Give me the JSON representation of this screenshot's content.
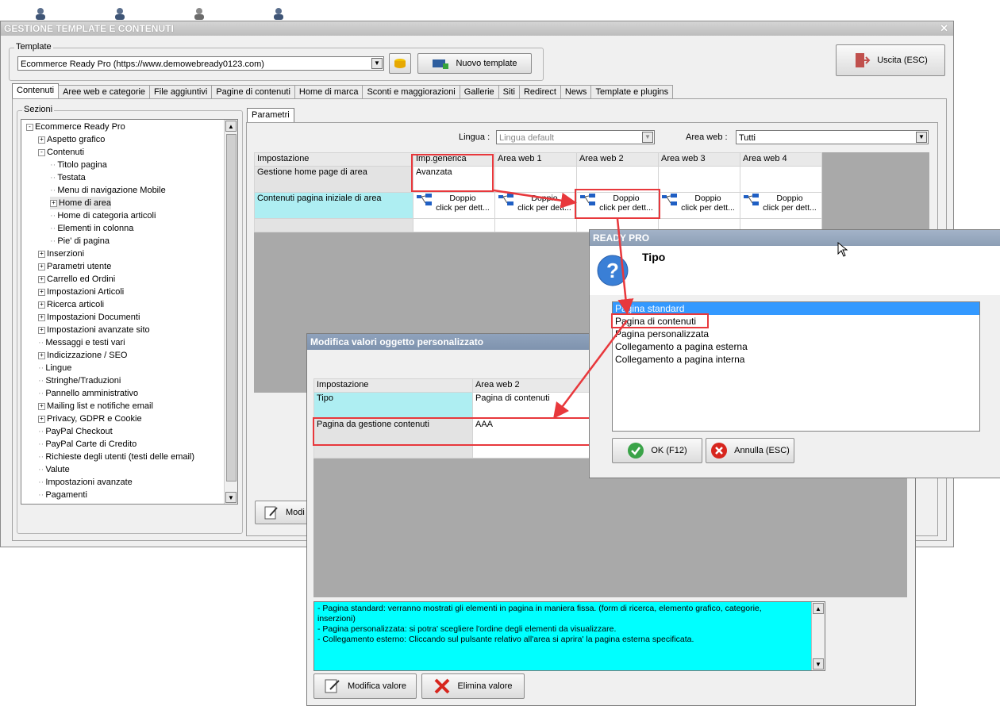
{
  "main_window": {
    "title": "GESTIONE TEMPLATE E CONTENUTI",
    "template_group_label": "Template",
    "template_value": "Ecommerce Ready Pro (https://www.demowebready0123.com)",
    "new_template_button": "Nuovo template",
    "exit_button": "Uscita (ESC)",
    "tabs": [
      "Contenuti",
      "Aree web e categorie",
      "File aggiuntivi",
      "Pagine di contenuti",
      "Home di marca",
      "Sconti e maggiorazioni",
      "Gallerie",
      "Siti",
      "Redirect",
      "News",
      "Template e plugins"
    ],
    "sections_label": "Sezioni",
    "tree": [
      {
        "label": "Ecommerce Ready Pro",
        "level": 0,
        "exp": "-"
      },
      {
        "label": "Aspetto grafico",
        "level": 1,
        "exp": "+"
      },
      {
        "label": "Contenuti",
        "level": 1,
        "exp": "-"
      },
      {
        "label": "Titolo pagina",
        "level": 2,
        "exp": ""
      },
      {
        "label": "Testata",
        "level": 2,
        "exp": ""
      },
      {
        "label": "Menu di navigazione Mobile",
        "level": 2,
        "exp": ""
      },
      {
        "label": "Home di area",
        "level": 2,
        "exp": "+",
        "selected": true
      },
      {
        "label": "Home di categoria articoli",
        "level": 2,
        "exp": ""
      },
      {
        "label": "Elementi in colonna",
        "level": 2,
        "exp": ""
      },
      {
        "label": "Pie' di pagina",
        "level": 2,
        "exp": ""
      },
      {
        "label": "Inserzioni",
        "level": 1,
        "exp": "+"
      },
      {
        "label": "Parametri utente",
        "level": 1,
        "exp": "+"
      },
      {
        "label": "Carrello ed Ordini",
        "level": 1,
        "exp": "+"
      },
      {
        "label": "Impostazioni Articoli",
        "level": 1,
        "exp": "+"
      },
      {
        "label": "Ricerca articoli",
        "level": 1,
        "exp": "+"
      },
      {
        "label": "Impostazioni Documenti",
        "level": 1,
        "exp": "+"
      },
      {
        "label": "Impostazioni avanzate sito",
        "level": 1,
        "exp": "+"
      },
      {
        "label": "Messaggi e testi vari",
        "level": 1,
        "exp": ""
      },
      {
        "label": "Indicizzazione / SEO",
        "level": 1,
        "exp": "+"
      },
      {
        "label": "Lingue",
        "level": 1,
        "exp": ""
      },
      {
        "label": "Stringhe/Traduzioni",
        "level": 1,
        "exp": ""
      },
      {
        "label": "Pannello amministrativo",
        "level": 1,
        "exp": ""
      },
      {
        "label": "Mailing list e notifiche email",
        "level": 1,
        "exp": "+"
      },
      {
        "label": "Privacy, GDPR e Cookie",
        "level": 1,
        "exp": "+"
      },
      {
        "label": "PayPal Checkout",
        "level": 1,
        "exp": ""
      },
      {
        "label": "PayPal Carte di Credito",
        "level": 1,
        "exp": ""
      },
      {
        "label": "Richieste degli utenti (testi delle email)",
        "level": 1,
        "exp": ""
      },
      {
        "label": "Valute",
        "level": 1,
        "exp": ""
      },
      {
        "label": "Impostazioni avanzate",
        "level": 1,
        "exp": ""
      },
      {
        "label": "Pagamenti",
        "level": 1,
        "exp": ""
      }
    ],
    "params_tab": "Parametri",
    "lingua_label": "Lingua :",
    "lingua_value": "Lingua default",
    "area_label": "Area web :",
    "area_value": "Tutti",
    "grid_headers": [
      "Impostazione",
      "Imp.generica",
      "Area web 1",
      "Area web 2",
      "Area web 3",
      "Area web 4"
    ],
    "grid_row1": {
      "label": "Gestione home page di area",
      "value": "Avanzata"
    },
    "grid_row2": {
      "label": "Contenuti pagina iniziale di area",
      "cell_line1": "Doppio",
      "cell_line2": "click per dett..."
    },
    "modify_button_partial": "Modi"
  },
  "tipo_dialog": {
    "title": "READY PRO",
    "heading": "Tipo",
    "options": [
      "Pagina standard",
      "Pagina di contenuti",
      "Pagina personalizzata",
      "Collegamento a pagina esterna",
      "Collegamento a pagina interna"
    ],
    "ok_button": "OK (F12)",
    "cancel_button": "Annulla (ESC)"
  },
  "edit_dialog": {
    "title": "Modifica valori oggetto personalizzato",
    "headers": [
      "Impostazione",
      "Area web 2"
    ],
    "rows": [
      {
        "label": "Tipo",
        "value": "Pagina di contenuti"
      },
      {
        "label": "Pagina da gestione contenuti",
        "value": "AAA"
      }
    ],
    "help_lines": [
      "- Pagina standard: verranno mostrati gli elementi in pagina in maniera fissa. (form di ricerca, elemento grafico, categorie,",
      "inserzioni)",
      "- Pagina personalizzata: si potra' scegliere l'ordine degli elementi da visualizzare.",
      "- Collegamento esterno: Cliccando sul pulsante relativo all'area si aprira' la pagina esterna specificata."
    ],
    "modify_button": "Modifica valore",
    "delete_button": "Elimina valore"
  },
  "colors": {
    "accent_red": "#e8383c",
    "selection_blue": "#3399ff",
    "cyan_cell": "#aeeef2",
    "help_bg": "#00ffff"
  }
}
